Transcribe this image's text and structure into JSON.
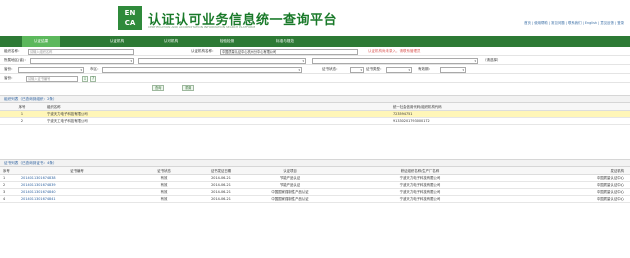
{
  "header": {
    "logo_top": "EN",
    "logo_bottom": "CA",
    "title": "认证认可业务信息统一查询平台",
    "subtitle": "CERTIFICATION AND ACCREDITATION INFORMATION SEARCH PLATFORM",
    "top_links": "首页  |  使用帮助  |  常见问题  |  联系我们  |  English  |  意见反馈  |  登录"
  },
  "nav": {
    "tabs": [
      "认证结果",
      "认证机构",
      "认可机构",
      "检验检测",
      "标准与规范"
    ],
    "active_index": 0
  },
  "form": {
    "org_label": "组织名称：",
    "org_placeholder": "请输入组织名称",
    "cert_org_label": "认证机构名称：",
    "cert_org_value": "中国质量认证中心杭州分中心有限公司",
    "hint_text": "认证机构尚未录入，请联系管理员",
    "city_label": "所属地区(省)：",
    "region_label": "认证项目：",
    "region_value": "",
    "extra_label": "（请选择）",
    "province_label": "省份：",
    "district_label": "市区：",
    "search_placeholder": "请输入证书编号",
    "cert_status_label": "证书状态：",
    "cert_status_value": "",
    "type_label": "证书类型：",
    "type_value": "",
    "valid_label": "有效期：",
    "valid_value": "",
    "query_button": "查询",
    "reset_button": "重置",
    "export_icon": "export-icon",
    "help_icon": "help-icon"
  },
  "org_section": {
    "title": "组织列表（已查询到组织：2条）",
    "columns": [
      "序号",
      "组织名称",
      "统一社会信用代码/组织机构代码"
    ],
    "rows": [
      {
        "no": "1",
        "name": "宁波天力电子科技有限公司",
        "code": "723594751"
      },
      {
        "no": "2",
        "name": "宁波天工电子科技有限公司",
        "code": "91330201793000172"
      }
    ],
    "selected_index": 0
  },
  "cert_section": {
    "title": "证书列表（已查询到证书：4条）",
    "columns": [
      "序号",
      "证书编号",
      "证书状态",
      "证书发证日期",
      "认证项目",
      "获证组织名称/生产厂名称",
      "发证机构"
    ],
    "rows": [
      {
        "no": "1",
        "cert_no": "2014011301674838",
        "status": "有效",
        "date": "2014-06-21",
        "project": "节能产品认证",
        "org": "宁波天力电子科技有限公司",
        "issuer": "中国质量认证中心"
      },
      {
        "no": "2",
        "cert_no": "2014011301674839",
        "status": "有效",
        "date": "2014-06-21",
        "project": "节能产品认证",
        "org": "宁波天力电子科技有限公司",
        "issuer": "中国质量认证中心"
      },
      {
        "no": "3",
        "cert_no": "2014011301674840",
        "status": "有效",
        "date": "2014-06-21",
        "project": "中国国家强制性产品认证",
        "org": "宁波天力电子科技有限公司",
        "issuer": "中国质量认证中心"
      },
      {
        "no": "4",
        "cert_no": "2014011301674841",
        "status": "有效",
        "date": "2014-06-21",
        "project": "中国国家强制性产品认证",
        "org": "宁波天力电子科技有限公司",
        "issuer": "中国质量认证中心"
      }
    ]
  }
}
